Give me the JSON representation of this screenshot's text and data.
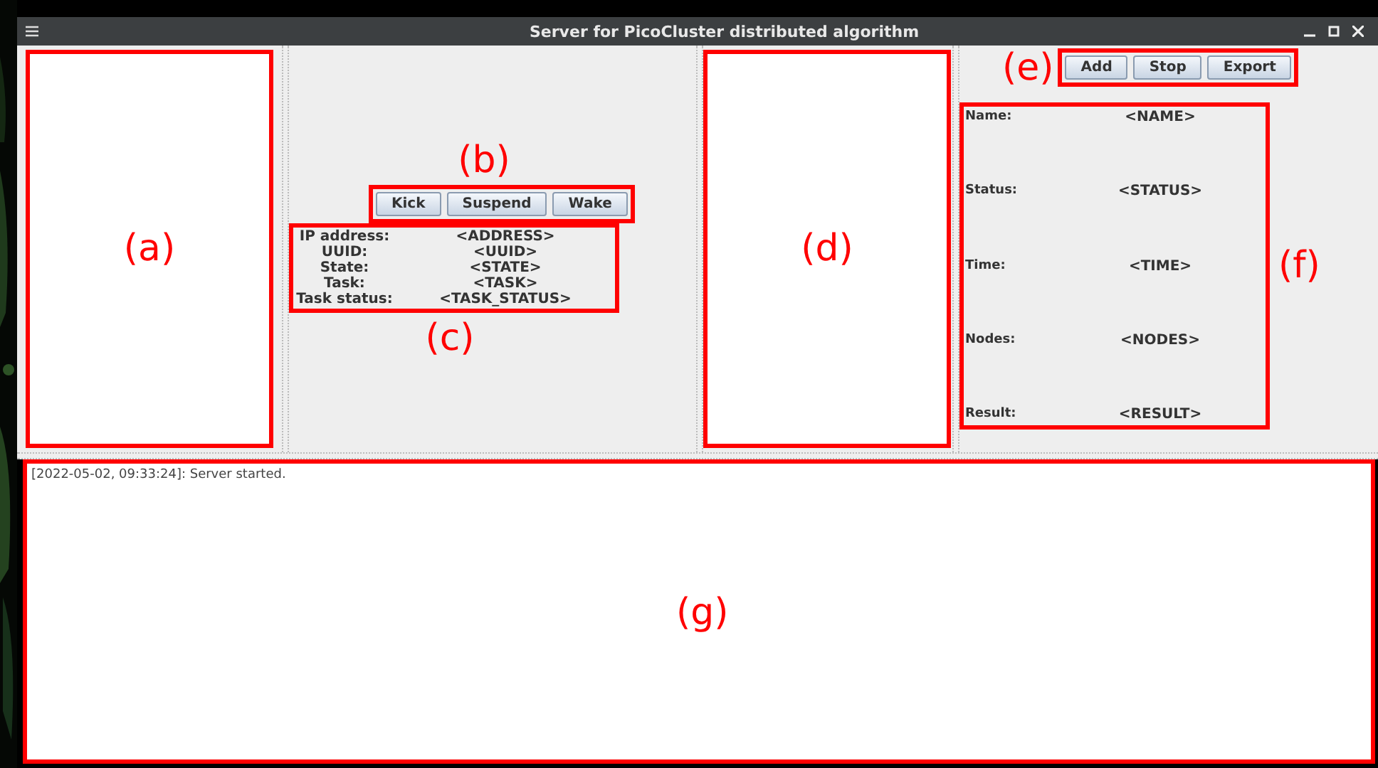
{
  "window": {
    "title": "Server for PicoCluster distributed algorithm"
  },
  "node_actions": [
    "Kick",
    "Suspend",
    "Wake"
  ],
  "node_info": [
    {
      "label": "IP address:",
      "value": "<ADDRESS>"
    },
    {
      "label": "UUID:",
      "value": "<UUID>"
    },
    {
      "label": "State:",
      "value": "<STATE>"
    },
    {
      "label": "Task:",
      "value": "<TASK>"
    },
    {
      "label": "Task status:",
      "value": "<TASK_STATUS>"
    }
  ],
  "task_actions": [
    "Add",
    "Stop",
    "Export"
  ],
  "task_info": [
    {
      "label": "Name:",
      "value": "<NAME>"
    },
    {
      "label": "Status:",
      "value": "<STATUS>"
    },
    {
      "label": "Time:",
      "value": "<TIME>"
    },
    {
      "label": "Nodes:",
      "value": "<NODES>"
    },
    {
      "label": "Result:",
      "value": "<RESULT>"
    }
  ],
  "log": [
    "[2022-05-02, 09:33:24]: Server started."
  ],
  "annotations": [
    "(a)",
    "(b)",
    "(c)",
    "(d)",
    "(e)",
    "(f)",
    "(g)"
  ]
}
